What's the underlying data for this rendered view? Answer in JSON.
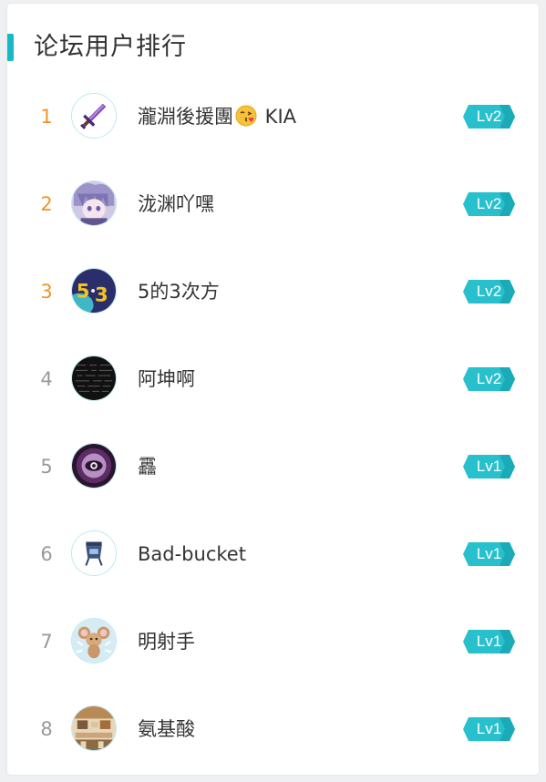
{
  "panel": {
    "title": "论坛用户排行",
    "accent_color": "#16b9c6"
  },
  "colors": {
    "rank_top": "#f0942a",
    "rank_normal": "#999999",
    "badge": "#27c0cc"
  },
  "users": [
    {
      "rank": "1",
      "name": "瀧淵後援團",
      "emoji": "face-blowing-kiss-icon",
      "name_suffix": " KIA",
      "level": "Lv2",
      "avatar": "sword-avatar"
    },
    {
      "rank": "2",
      "name": "泷渊吖嘿",
      "level": "Lv2",
      "avatar": "anime-avatar"
    },
    {
      "rank": "3",
      "name": "5的3次方",
      "level": "Lv2",
      "avatar": "five-three-avatar"
    },
    {
      "rank": "4",
      "name": "阿坤啊",
      "level": "Lv2",
      "avatar": "dark-text-avatar"
    },
    {
      "rank": "5",
      "name": "靐",
      "level": "Lv1",
      "avatar": "purple-eye-avatar"
    },
    {
      "rank": "6",
      "name": "Bad-bucket",
      "level": "Lv1",
      "avatar": "bucket-avatar"
    },
    {
      "rank": "7",
      "name": "明射手",
      "level": "Lv1",
      "avatar": "mouse-avatar"
    },
    {
      "rank": "8",
      "name": "氨基酸",
      "level": "Lv1",
      "avatar": "room-avatar"
    }
  ]
}
